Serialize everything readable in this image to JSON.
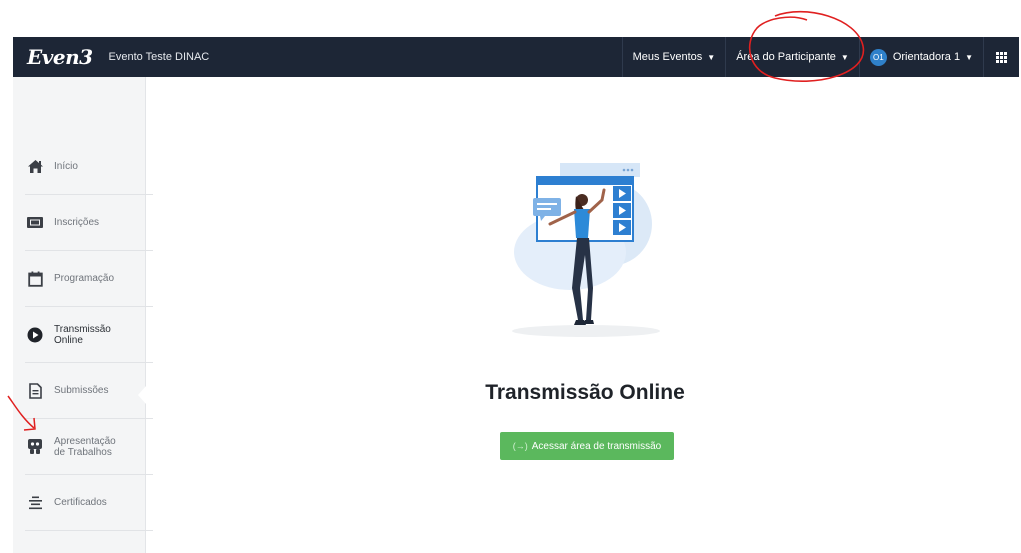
{
  "brand": {
    "logo": "Even3"
  },
  "header": {
    "event_name": "Evento Teste DINAC",
    "menu_events": "Meus Eventos",
    "menu_participant": "Área do Participante",
    "user_initials": "O1",
    "user_name": "Orientadora 1"
  },
  "sidebar": {
    "items": [
      {
        "label": "Início",
        "icon": "home-icon"
      },
      {
        "label": "Inscrições",
        "icon": "ticket-icon"
      },
      {
        "label": "Programação",
        "icon": "calendar-icon"
      },
      {
        "label": "Transmissão Online",
        "icon": "play-circle-icon",
        "active": true
      },
      {
        "label": "Submissões",
        "icon": "document-icon"
      },
      {
        "label": "Apresentação de Trabalhos",
        "icon": "presentation-icon"
      },
      {
        "label": "Certificados",
        "icon": "certificate-icon"
      }
    ]
  },
  "main": {
    "title": "Transmissão Online",
    "button_label": "Acessar área de transmissão",
    "button_icon": "sign-in-icon"
  },
  "colors": {
    "navbar": "#1d2636",
    "sidebar": "#f4f5f6",
    "button": "#5bb85d",
    "annotation": "#e02020",
    "illustration_accent": "#2d7fd1"
  }
}
